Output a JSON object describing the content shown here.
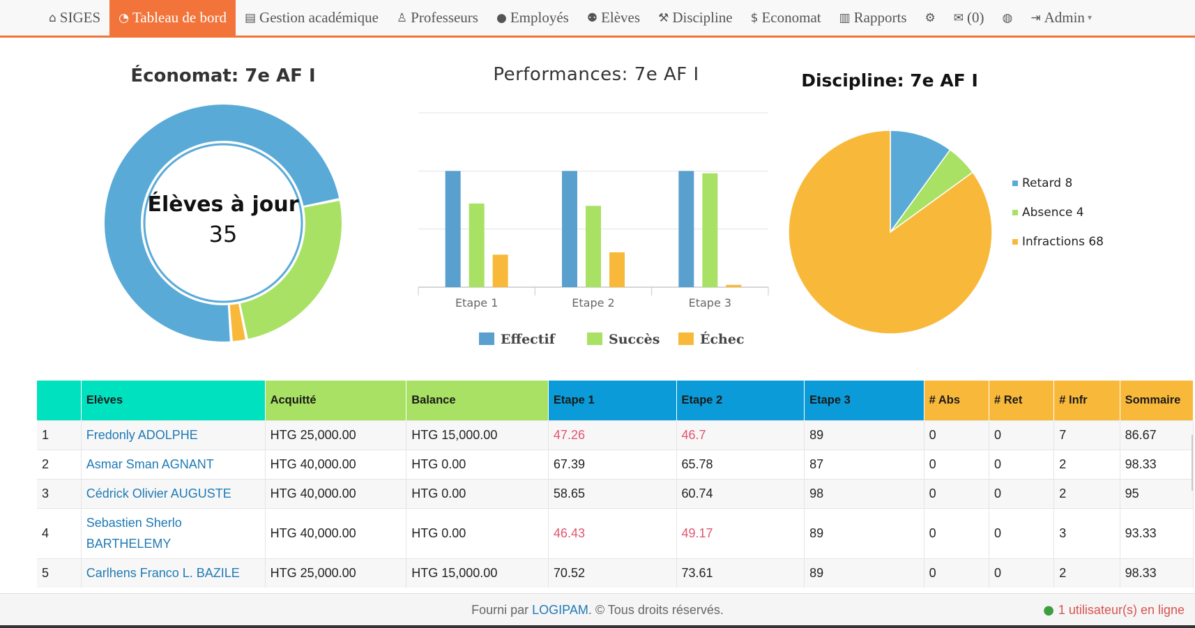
{
  "nav": {
    "items": [
      {
        "icon": "home-icon",
        "glyph": "⌂",
        "label": "SIGES",
        "active": false
      },
      {
        "icon": "dashboard-icon",
        "glyph": "◔",
        "label": "Tableau de bord",
        "active": true
      },
      {
        "icon": "briefcase-icon",
        "glyph": "▤",
        "label": "Gestion académique",
        "active": false
      },
      {
        "icon": "male-icon",
        "glyph": "♙",
        "label": "Professeurs",
        "active": false
      },
      {
        "icon": "user-icon",
        "glyph": "●",
        "label": "Employés",
        "active": false
      },
      {
        "icon": "users-icon",
        "glyph": "⚉",
        "label": "Elèves",
        "active": false
      },
      {
        "icon": "gavel-icon",
        "glyph": "⚒",
        "label": "Discipline",
        "active": false
      },
      {
        "icon": "dollar-icon",
        "glyph": "$",
        "label": "Economat",
        "active": false
      },
      {
        "icon": "bar-chart-icon",
        "glyph": "▥",
        "label": "Rapports",
        "active": false
      },
      {
        "icon": "cogs-icon",
        "glyph": "⚙",
        "label": "",
        "active": false
      },
      {
        "icon": "envelope-icon",
        "glyph": "✉",
        "label": "(0)",
        "active": false
      },
      {
        "icon": "globe-icon",
        "glyph": "◍",
        "label": "",
        "active": false
      },
      {
        "icon": "sign-out-icon",
        "glyph": "⇥",
        "label": "Admin",
        "active": false
      }
    ],
    "caret": "▾",
    "accent": "#f2743a"
  },
  "economat": {
    "title": "Économat: 7e AF I",
    "center_label": "Élèves à jour",
    "center_value": "35",
    "chart_data": {
      "type": "pie",
      "values": [
        35,
        12,
        1
      ],
      "colors": [
        "#5aaad8",
        "#a8e163",
        "#f8b93b"
      ]
    }
  },
  "performance": {
    "title": "Performances: 7e AF I",
    "chart_data": {
      "type": "bar",
      "categories": [
        "Etape 1",
        "Etape 2",
        "Etape 3"
      ],
      "series": [
        {
          "name": "Effectif",
          "values": [
            5,
            5,
            5
          ],
          "color": "#5aa0cf"
        },
        {
          "name": "Succès",
          "values": [
            3.6,
            3.5,
            4.9
          ],
          "color": "#a8e163"
        },
        {
          "name": "Échec",
          "values": [
            1.4,
            1.5,
            0.1
          ],
          "color": "#f8b93b"
        }
      ],
      "ylim": [
        0,
        7.5
      ],
      "grid": true,
      "legend": "bottom"
    }
  },
  "discipline": {
    "title": "Discipline: 7e AF I",
    "chart_data": {
      "type": "pie",
      "categories": [
        "Retard",
        "Absence",
        "Infractions"
      ],
      "values": [
        8,
        4,
        68
      ],
      "colors": [
        "#5aaad8",
        "#a8e163",
        "#f8b93b"
      ],
      "legend": "right"
    }
  },
  "table": {
    "headers": [
      "",
      "Elèves",
      "Acquitté",
      "Balance",
      "Etape 1",
      "Etape 2",
      "Etape 3",
      "# Abs",
      "# Ret",
      "# Infr",
      "Sommaire"
    ],
    "header_colors": [
      "#00e1bf",
      "#00e1bf",
      "#a8e163",
      "#a8e163",
      "#0a9bd8",
      "#0a9bd8",
      "#0a9bd8",
      "#f8b93b",
      "#f8b93b",
      "#f8b93b",
      "#f8b93b"
    ],
    "rows": [
      {
        "num": "1",
        "name": "Fredonly ADOLPHE",
        "paid": "HTG 25,000.00",
        "balance": "HTG 15,000.00",
        "e1": "47.26",
        "e1_low": true,
        "e2": "46.7",
        "e2_low": true,
        "e3": "89",
        "abs": "0",
        "ret": "0",
        "infr": "7",
        "sum": "86.67"
      },
      {
        "num": "2",
        "name": "Asmar Sman AGNANT",
        "paid": "HTG 40,000.00",
        "balance": "HTG 0.00",
        "e1": "67.39",
        "e1_low": false,
        "e2": "65.78",
        "e2_low": false,
        "e3": "87",
        "abs": "0",
        "ret": "0",
        "infr": "2",
        "sum": "98.33"
      },
      {
        "num": "3",
        "name": "Cédrick Olivier AUGUSTE",
        "paid": "HTG 40,000.00",
        "balance": "HTG 0.00",
        "e1": "58.65",
        "e1_low": false,
        "e2": "60.74",
        "e2_low": false,
        "e3": "98",
        "abs": "0",
        "ret": "0",
        "infr": "2",
        "sum": "95"
      },
      {
        "num": "4",
        "name": "Sebastien Sherlo BARTHELEMY",
        "paid": "HTG 40,000.00",
        "balance": "HTG 0.00",
        "e1": "46.43",
        "e1_low": true,
        "e2": "49.17",
        "e2_low": true,
        "e3": "89",
        "abs": "0",
        "ret": "0",
        "infr": "3",
        "sum": "93.33"
      },
      {
        "num": "5",
        "name": "Carlhens Franco L. BAZILE",
        "paid": "HTG 25,000.00",
        "balance": "HTG 15,000.00",
        "e1": "70.52",
        "e1_low": false,
        "e2": "73.61",
        "e2_low": false,
        "e3": "89",
        "abs": "0",
        "ret": "0",
        "infr": "2",
        "sum": "98.33"
      }
    ]
  },
  "footer": {
    "prefix": "Fourni par ",
    "brand": "LOGIPAM",
    "suffix": ". © Tous droits réservés.",
    "online": "1 utilisateur(s) en ligne"
  }
}
